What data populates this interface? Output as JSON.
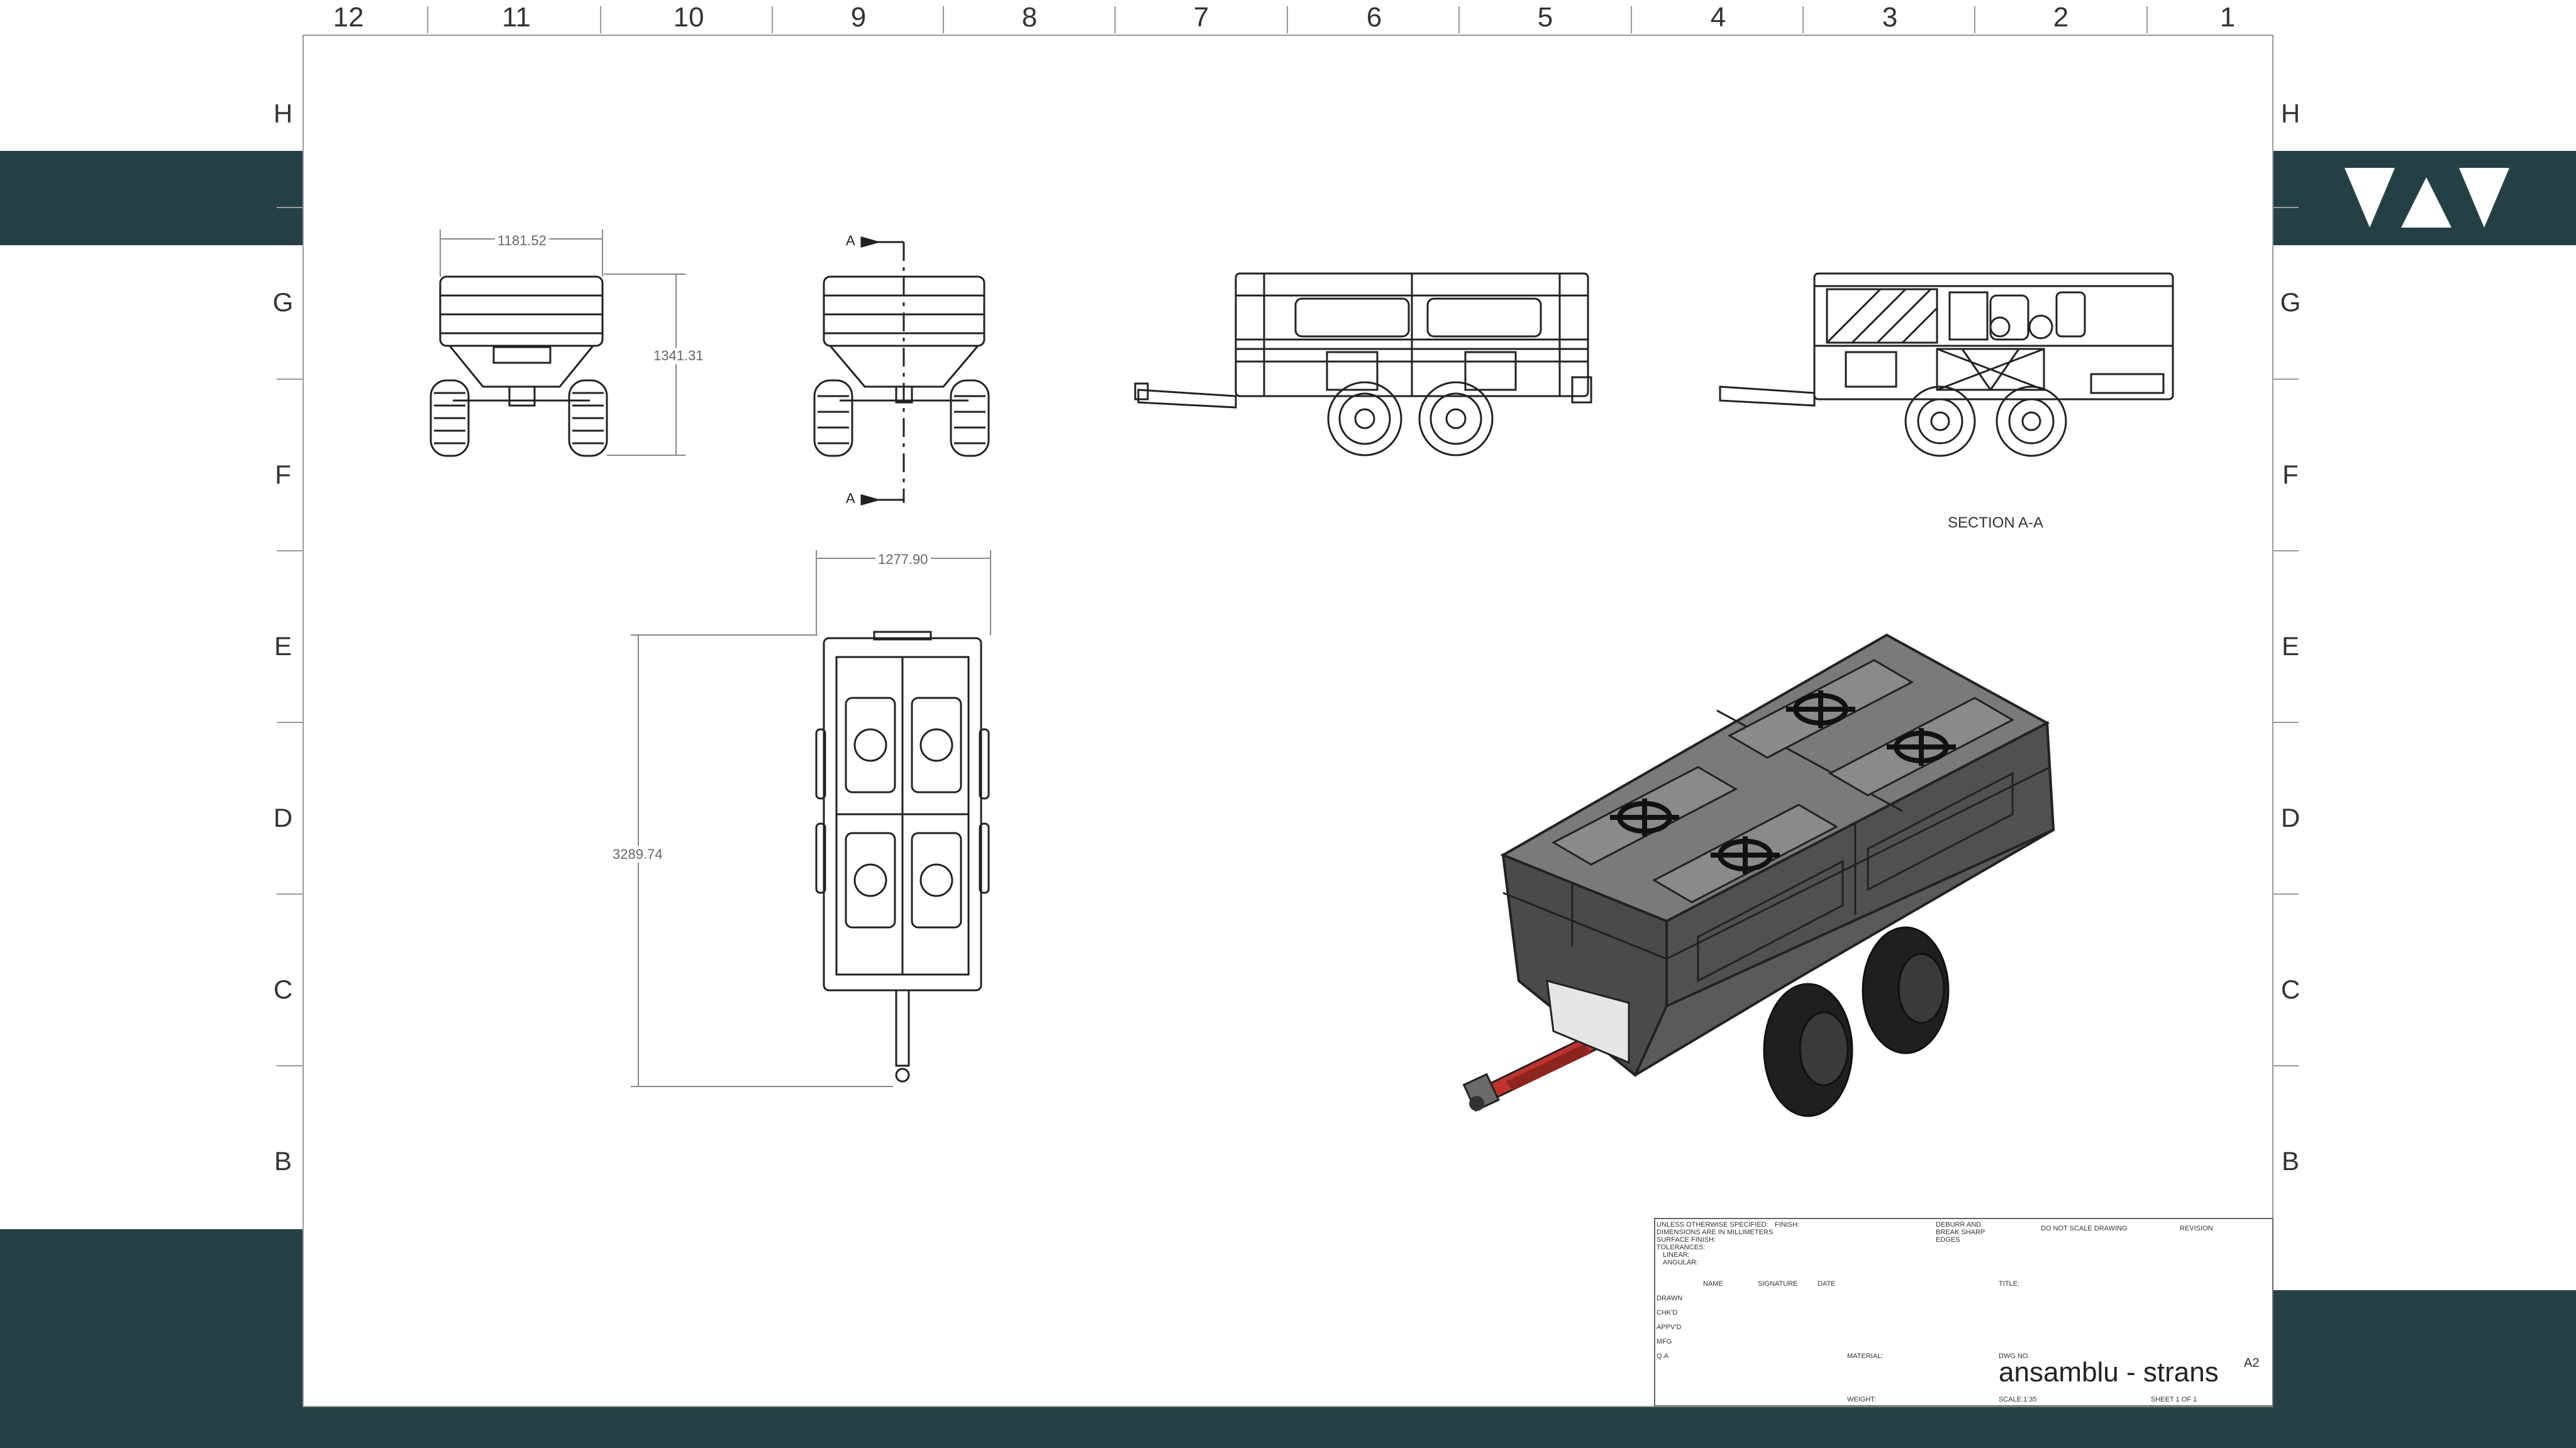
{
  "border": {
    "columns": [
      "12",
      "11",
      "10",
      "9",
      "8",
      "7",
      "6",
      "5",
      "4",
      "3",
      "2",
      "1"
    ],
    "rows": [
      "H",
      "G",
      "F",
      "E",
      "D",
      "C",
      "B"
    ]
  },
  "colors": {
    "band": "#253f46",
    "frame_red": "#c0332b",
    "body_gray": "#5a5a5a"
  },
  "logo_icon": "triangle-w-logo-icon",
  "dimensions": {
    "rear_width": "1181.52",
    "rear_height": "1341.31",
    "top_width": "1277.90",
    "top_length": "3289.74",
    "section_mark_top": "A",
    "section_mark_bottom": "A"
  },
  "section_label": "SECTION A-A",
  "title_block": {
    "notes": [
      "UNLESS OTHERWISE SPECIFIED:",
      "DIMENSIONS ARE IN MILLIMETERS",
      "SURFACE FINISH:",
      "TOLERANCES:",
      "LINEAR:",
      "ANGULAR:"
    ],
    "finish": "FINISH:",
    "deburr": [
      "DEBURR AND",
      "BREAK SHARP",
      "EDGES"
    ],
    "do_not_scale": "DO NOT SCALE DRAWING",
    "revision": "REVISION",
    "headers": [
      "NAME",
      "SIGNATURE",
      "DATE"
    ],
    "roles": [
      "DRAWN",
      "CHK'D",
      "APPV'D",
      "MFG",
      "Q.A"
    ],
    "title_label": "TITLE:",
    "material": "MATERIAL:",
    "dwg_no_label": "DWG NO.",
    "dwg_no": "ansamblu - strans",
    "size": "A2",
    "weight": "WEIGHT:",
    "scale": "SCALE:1:35",
    "sheet": "SHEET 1 OF 1"
  }
}
